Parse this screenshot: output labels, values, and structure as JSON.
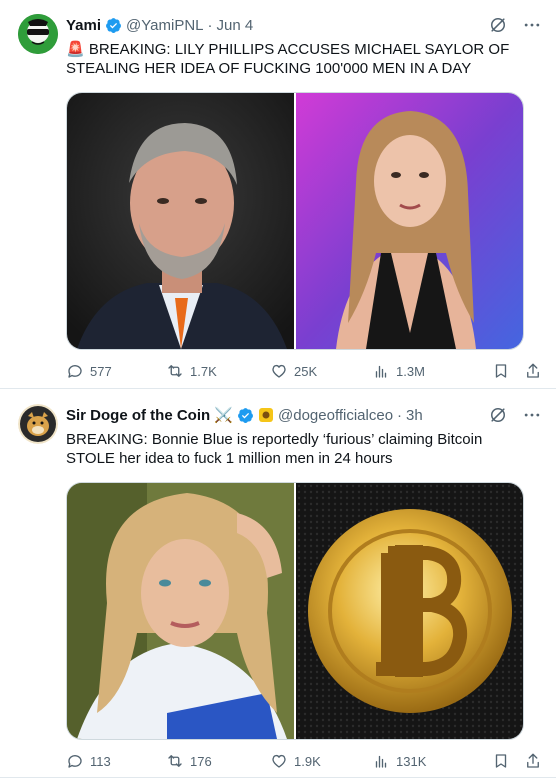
{
  "colors": {
    "verified": "#1d9bf0",
    "text": "#0f1419",
    "muted": "#536471"
  },
  "tweets": [
    {
      "name": "Yami",
      "handle": "@YamiPNL",
      "sep": "·",
      "time": "Jun 4",
      "text": "🚨 BREAKING: LILY PHILLIPS ACCUSES MICHAEL SAYLOR OF STEALING HER IDEA OF FUCKING 100'000 MEN IN A DAY",
      "stats": {
        "replies": "577",
        "retweets": "1.7K",
        "likes": "25K",
        "views": "1.3M"
      }
    },
    {
      "name": "Sir Doge of the Coin ⚔️",
      "handle": "@dogeofficialceo",
      "sep": "·",
      "time": "3h",
      "text": "BREAKING: Bonnie Blue is reportedly ‘furious’ claiming Bitcoin STOLE her idea to fuck 1 million men in 24 hours",
      "stats": {
        "replies": "113",
        "retweets": "176",
        "likes": "1.9K",
        "views": "131K"
      }
    }
  ]
}
